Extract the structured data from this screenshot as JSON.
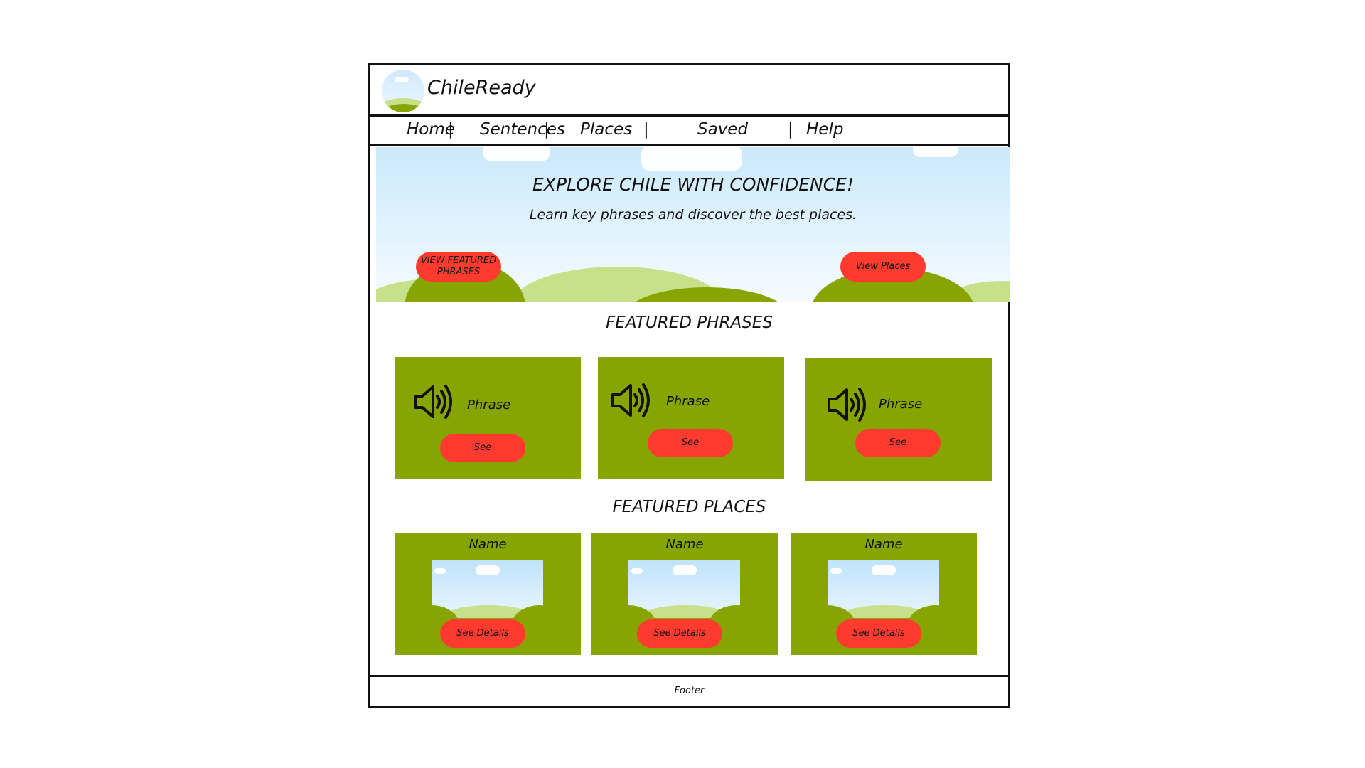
{
  "app": {
    "title": "ChileReady"
  },
  "nav": {
    "items": [
      {
        "label": "Home"
      },
      {
        "label": "Sentences"
      },
      {
        "label": "Places"
      },
      {
        "label": "Saved"
      },
      {
        "label": "Help"
      }
    ],
    "separator": "|"
  },
  "hero": {
    "title": "EXPLORE CHILE WITH CONFIDENCE!",
    "subtitle": "Learn key phrases and discover the best places.",
    "primary_button": "VIEW FEATURED PHRASES",
    "secondary_button": "View Places"
  },
  "featured_phrases": {
    "title": "FEATURED PHRASES",
    "cards": [
      {
        "label": "Phrase",
        "button": "See",
        "icon": "speaker-icon"
      },
      {
        "label": "Phrase",
        "button": "See",
        "icon": "speaker-icon"
      },
      {
        "label": "Phrase",
        "button": "See",
        "icon": "speaker-icon"
      }
    ]
  },
  "featured_places": {
    "title": "FEATURED PLACES",
    "cards": [
      {
        "name": "Name",
        "button": "See Details"
      },
      {
        "name": "Name",
        "button": "See Details"
      },
      {
        "name": "Name",
        "button": "See Details"
      }
    ]
  },
  "footer": {
    "text": "Footer"
  },
  "colors": {
    "accent": "#ff3b30",
    "card": "#87a400",
    "sky": "#cbe9fb",
    "hill_light": "#c7e08a"
  }
}
